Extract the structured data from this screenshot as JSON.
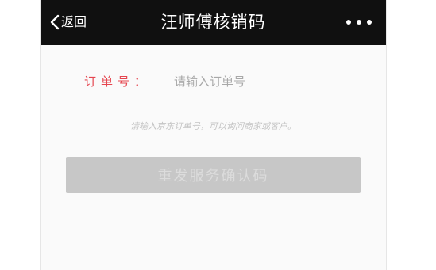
{
  "navbar": {
    "back_label": "返回",
    "title": "汪师傅核销码",
    "more_icon": "more-dots-icon"
  },
  "form": {
    "order_label": "订单号：",
    "order_value": "",
    "order_placeholder": "请输入订单号",
    "hint": "请输入京东订单号，可以询问商家或客户。",
    "submit_label": "重发服务确认码",
    "submit_enabled": false
  },
  "colors": {
    "navbar_bg": "#101010",
    "label_red": "#e5454f",
    "button_disabled": "#c7c7c7"
  }
}
